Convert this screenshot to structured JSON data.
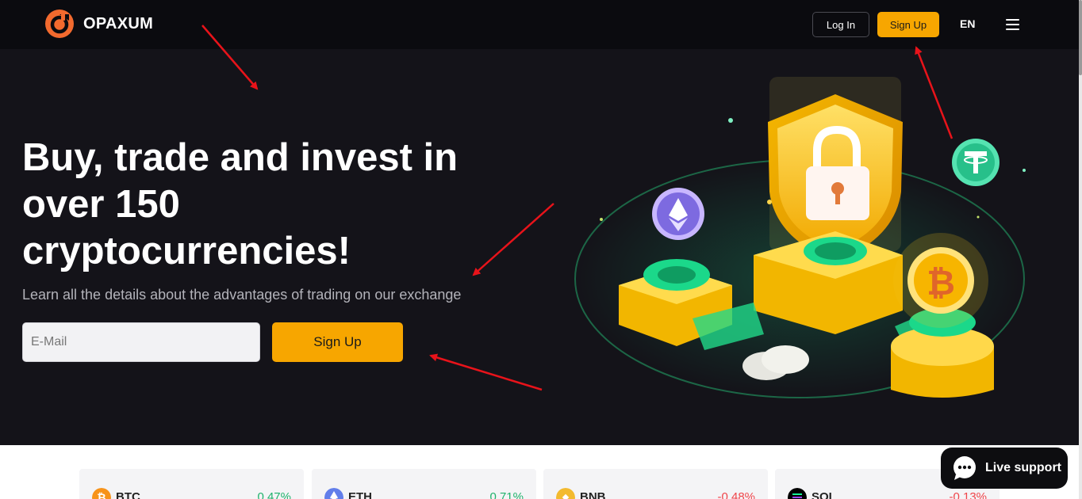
{
  "header": {
    "brand": "OPAXUM",
    "login_label": "Log In",
    "signup_label": "Sign Up",
    "language": "EN"
  },
  "hero": {
    "title": "Buy, trade and invest in over 150 cryptocurrencies!",
    "subtitle": "Learn all the details about the advantages of trading on our exchange",
    "email_placeholder": "E-Mail",
    "signup_label": "Sign Up"
  },
  "ticker": [
    {
      "symbol": "BTC",
      "change": "0.47%",
      "trend": "up",
      "icon": "bitcoin-icon",
      "color": "#f7931a"
    },
    {
      "symbol": "ETH",
      "change": "0.71%",
      "trend": "up",
      "icon": "ethereum-icon",
      "color": "#627eea"
    },
    {
      "symbol": "BNB",
      "change": "-0.48%",
      "trend": "down",
      "icon": "bnb-icon",
      "color": "#f3ba2f"
    },
    {
      "symbol": "SOL",
      "change": "-0.13%",
      "trend": "down",
      "icon": "solana-icon",
      "color": "#000000"
    }
  ],
  "live_support": {
    "label": "Live support"
  },
  "colors": {
    "accent": "#f7a600",
    "header_bg": "#0b0b0f",
    "hero_bg": "#141319",
    "positive": "#20b26c",
    "negative": "#ef454a"
  }
}
